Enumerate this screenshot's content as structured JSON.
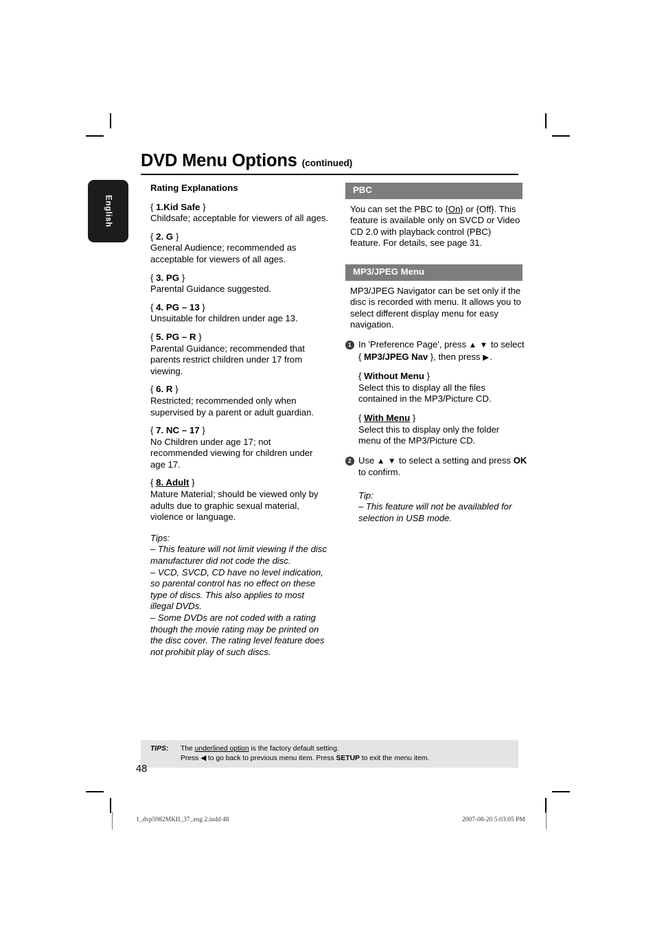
{
  "header": {
    "title": "DVD Menu Options",
    "continued": "(continued)"
  },
  "language_tab": {
    "label": "English"
  },
  "left_column": {
    "subhead": "Rating Explanations",
    "ratings": [
      {
        "term_prefix": "{ ",
        "term_bold": "1.Kid Safe",
        "term_suffix": " }",
        "underlined": false,
        "description": "Childsafe; acceptable for viewers of all ages."
      },
      {
        "term_prefix": "{ ",
        "term_bold": "2. G",
        "term_suffix": " }",
        "underlined": false,
        "description": "General Audience; recommended as acceptable for viewers of all ages."
      },
      {
        "term_prefix": "{ ",
        "term_bold": "3. PG",
        "term_suffix": " }",
        "underlined": false,
        "description": "Parental Guidance suggested."
      },
      {
        "term_prefix": "{ ",
        "term_bold": "4. PG – 13",
        "term_suffix": " }",
        "underlined": false,
        "description": "Unsuitable for children under age 13."
      },
      {
        "term_prefix": "{ ",
        "term_bold": "5. PG – R",
        "term_suffix": " }",
        "underlined": false,
        "description": "Parental Guidance; recommended that parents restrict children under 17 from viewing."
      },
      {
        "term_prefix": "{ ",
        "term_bold": "6. R",
        "term_suffix": " }",
        "underlined": false,
        "description": "Restricted; recommended only when supervised by a parent or adult guardian."
      },
      {
        "term_prefix": "{ ",
        "term_bold": "7. NC – 17",
        "term_suffix": " }",
        "underlined": false,
        "description": "No Children under age 17; not recommended viewing for children under age 17."
      },
      {
        "term_prefix": "{ ",
        "term_bold": "8. Adult",
        "term_suffix": " }",
        "underlined": true,
        "description": "Mature Material; should be viewed only by adults due to graphic sexual material, violence or language."
      }
    ],
    "tips_label": "Tips:",
    "tips": [
      "– This feature will not limit viewing if the disc manufacturer did not code the disc.",
      "– VCD, SVCD, CD have no level indication, so parental control has no effect on these type of discs. This also applies to most illegal DVDs.",
      "– Some DVDs are not coded with a rating though the movie rating may be printed on the disc cover. The rating level feature does not prohibit play of such discs."
    ]
  },
  "right_column": {
    "pbc": {
      "bar_label": "PBC",
      "line1_a": "You can set the PBC to {",
      "line1_on": "On",
      "line1_b": "} or {Off}. This feature is available only on SVCD or Video CD 2.0 with playback control (PBC) feature. For details, see page 31."
    },
    "mp3jpeg": {
      "bar_label": "MP3/JPEG Menu",
      "intro": "MP3/JPEG Navigator can be set only if the disc is recorded with menu. It allows you to select different display menu for easy navigation.",
      "step1": {
        "num": "1",
        "text_a": "In 'Preference Page', press ",
        "arrow_up": "▲",
        "arrow_down": "▼",
        "text_b": " to select",
        "text_c": "{ ",
        "option_bold": "MP3/JPEG Nav",
        "text_d": " }, then press ",
        "arrow_right": "▶",
        "text_e": "."
      },
      "options": [
        {
          "term_prefix": "{ ",
          "term_bold": "Without Menu",
          "term_suffix": " }",
          "underlined": false,
          "description": "Select this to display all the files contained in the MP3/Picture CD."
        },
        {
          "term_prefix": "{ ",
          "term_bold": "With Menu",
          "term_suffix": " }",
          "underlined": true,
          "description": "Select this to display only the folder menu of the MP3/Picture CD."
        }
      ],
      "step2": {
        "num": "2",
        "text_a": "Use ",
        "arrow_up": "▲",
        "arrow_down": "▼",
        "text_b": " to select a setting and press ",
        "ok_bold": "OK",
        "text_c": " to confirm."
      },
      "tip_label": "Tip:",
      "tip_text": "– This feature will not be availabled for selection in USB mode."
    }
  },
  "tips_strip": {
    "label": "TIPS:",
    "line1_a": "The ",
    "line1_u": "underlined option",
    "line1_b": " is the factory default setting.",
    "line2_a": "Press ",
    "line2_arrow": "◀",
    "line2_b": " to go back to previous menu item. Press ",
    "line2_bold": "SETUP",
    "line2_c": " to exit the menu item."
  },
  "page_number": "48",
  "print_footer": {
    "left": "1_dvp5982MKII_37_eng 2.indd   48",
    "right": "2007-08-20   5:03:05 PM"
  },
  "colors": {
    "section_bar": "#7d7d7d",
    "tips_strip": "#e4e4e4",
    "tab": "#1c1c1c",
    "bullet": "#3b3b3b"
  }
}
